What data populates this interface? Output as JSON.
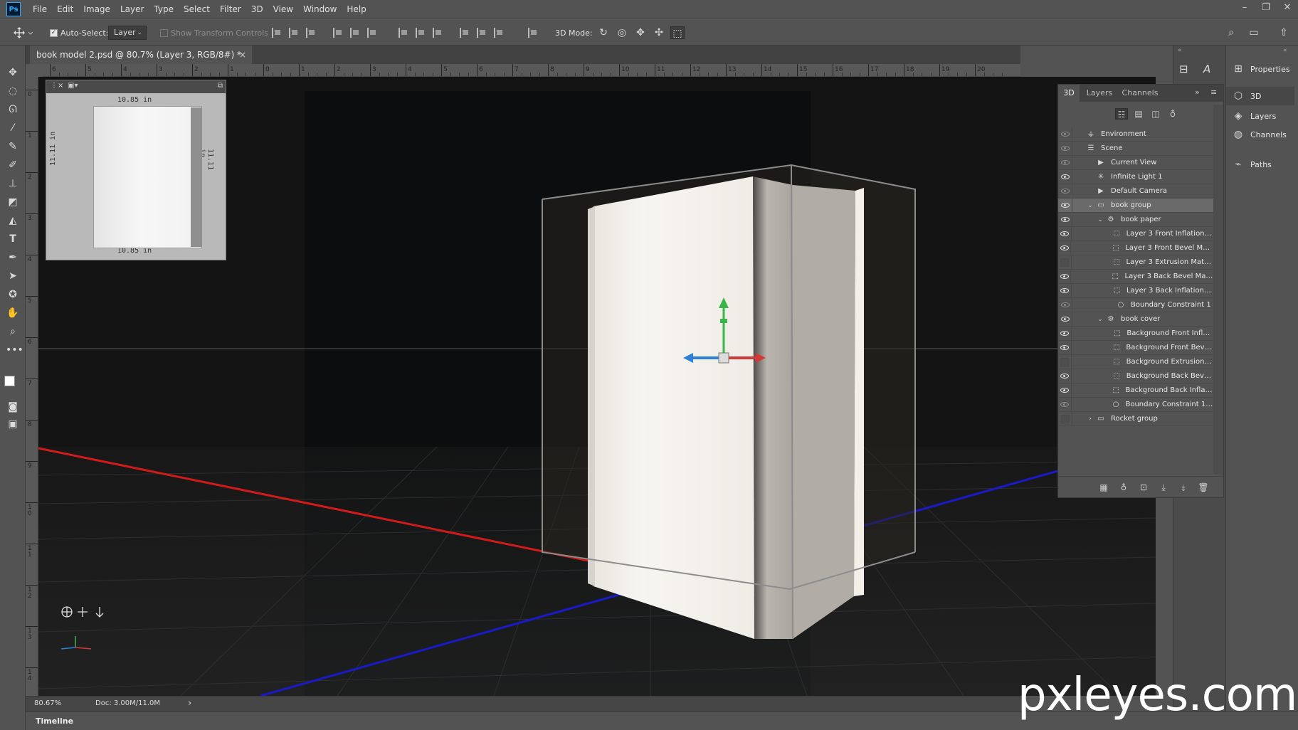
{
  "app": {
    "logo_text": "Ps"
  },
  "menu": [
    "File",
    "Edit",
    "Image",
    "Layer",
    "Type",
    "Select",
    "Filter",
    "3D",
    "View",
    "Window",
    "Help"
  ],
  "window_controls": {
    "minimize": "–",
    "restore": "❐",
    "close": "✕"
  },
  "options_bar": {
    "auto_select_label": "Auto-Select:",
    "auto_select_checked": true,
    "auto_select_target": "Layer",
    "show_transform_label": "Show Transform Controls",
    "mode_3d_label": "3D Mode:"
  },
  "document": {
    "tab_title": "book model 2.psd @ 80.7% (Layer 3, RGB/8#) *",
    "close": "×"
  },
  "rulers": {
    "horizontal": [
      "6",
      "5",
      "4",
      "3",
      "2",
      "1",
      "0",
      "1",
      "2",
      "3",
      "4",
      "5",
      "6",
      "7",
      "8",
      "9",
      "10",
      "11",
      "12",
      "13",
      "14",
      "15",
      "16",
      "17",
      "18",
      "19",
      "20"
    ],
    "vertical": [
      "0",
      "1",
      "2",
      "3",
      "4",
      "5",
      "6",
      "7",
      "8",
      "9",
      "10",
      "11",
      "12",
      "13",
      "14"
    ]
  },
  "secondary_view": {
    "top_dim": "10.85 in",
    "bottom_dim": "10.85 in",
    "left_dim": "11.11 in",
    "right_dim": "11.11 in"
  },
  "status": {
    "zoom": "80.67%",
    "doc_info": "Doc: 3.00M/11.0M",
    "arrow": "›"
  },
  "timeline": {
    "label": "Timeline"
  },
  "right_panels": [
    {
      "label": "Properties",
      "icon": "properties-icon"
    },
    {
      "label": "3D",
      "icon": "cube-icon"
    },
    {
      "label": "Layers",
      "icon": "layers-icon"
    },
    {
      "label": "Channels",
      "icon": "channels-icon"
    },
    {
      "label": "Paths",
      "icon": "paths-icon"
    }
  ],
  "panel3d": {
    "tabs": [
      "3D",
      "Layers",
      "Channels"
    ],
    "active_tab": "3D",
    "rows": [
      {
        "label": "Environment",
        "eye": "off",
        "indent": 0,
        "twirl": "",
        "icon": "environment-icon",
        "glyph": "⚶"
      },
      {
        "label": "Scene",
        "eye": "off",
        "indent": 0,
        "twirl": "",
        "icon": "scene-icon",
        "glyph": "☰"
      },
      {
        "label": "Current View",
        "eye": "off",
        "indent": 1,
        "twirl": "",
        "icon": "camera-icon",
        "glyph": "▶"
      },
      {
        "label": "Infinite Light 1",
        "eye": "on",
        "indent": 1,
        "twirl": "",
        "icon": "light-icon",
        "glyph": "✳"
      },
      {
        "label": "Default Camera",
        "eye": "off",
        "indent": 1,
        "twirl": "",
        "icon": "camera-icon",
        "glyph": "▶"
      },
      {
        "label": "book group",
        "eye": "on",
        "indent": 1,
        "twirl": "⌄",
        "icon": "folder-icon",
        "glyph": "▭",
        "selected": true
      },
      {
        "label": "book paper",
        "eye": "on",
        "indent": 2,
        "twirl": "⌄",
        "icon": "mesh-icon",
        "glyph": "⚙"
      },
      {
        "label": "Layer 3 Front Inflation M...",
        "eye": "on",
        "indent": 3,
        "twirl": "",
        "icon": "material-icon",
        "glyph": "⬚"
      },
      {
        "label": "Layer 3 Front Bevel Mate...",
        "eye": "on",
        "indent": 3,
        "twirl": "",
        "icon": "material-icon",
        "glyph": "⬚"
      },
      {
        "label": "Layer 3 Extrusion Material",
        "eye": "none",
        "indent": 3,
        "twirl": "",
        "icon": "material-icon",
        "glyph": "⬚"
      },
      {
        "label": "Layer 3 Back Bevel Mater...",
        "eye": "on",
        "indent": 3,
        "twirl": "",
        "icon": "material-icon",
        "glyph": "⬚"
      },
      {
        "label": "Layer 3 Back Inflation M...",
        "eye": "on",
        "indent": 3,
        "twirl": "",
        "icon": "material-icon",
        "glyph": "⬚"
      },
      {
        "label": "Boundary Constraint 1",
        "eye": "off",
        "indent": 3,
        "twirl": "",
        "icon": "constraint-icon",
        "glyph": "○"
      },
      {
        "label": "book cover",
        "eye": "on",
        "indent": 2,
        "twirl": "⌄",
        "icon": "mesh-icon",
        "glyph": "⚙"
      },
      {
        "label": "Background Front Inflati...",
        "eye": "on",
        "indent": 3,
        "twirl": "",
        "icon": "material-icon",
        "glyph": "⬚"
      },
      {
        "label": "Background Front Bevel ...",
        "eye": "on",
        "indent": 3,
        "twirl": "",
        "icon": "material-icon",
        "glyph": "⬚"
      },
      {
        "label": "Background Extrusion M...",
        "eye": "none",
        "indent": 3,
        "twirl": "",
        "icon": "material-icon",
        "glyph": "⬚"
      },
      {
        "label": "Background Back Bevel ...",
        "eye": "on",
        "indent": 3,
        "twirl": "",
        "icon": "material-icon",
        "glyph": "⬚"
      },
      {
        "label": "Background Back Inflatio...",
        "eye": "on",
        "indent": 3,
        "twirl": "",
        "icon": "material-icon",
        "glyph": "⬚"
      },
      {
        "label": "Boundary Constraint 1_B...",
        "eye": "off",
        "indent": 3,
        "twirl": "",
        "icon": "constraint-icon",
        "glyph": "○"
      },
      {
        "label": "Rocket group",
        "eye": "none",
        "indent": 1,
        "twirl": "›",
        "icon": "folder-icon",
        "glyph": "▭"
      }
    ]
  },
  "watermark": "pxleyes.com",
  "colors": {
    "ui_bg": "#535353",
    "canvas_bg": "#151515",
    "x_axis": "#d11b1b",
    "z_axis": "#1a1ac8",
    "y_gizmo": "#39b54a",
    "x_gizmo": "#d23a3a",
    "z_gizmo": "#2f7fd6",
    "book_page": "#f3f0ea"
  }
}
